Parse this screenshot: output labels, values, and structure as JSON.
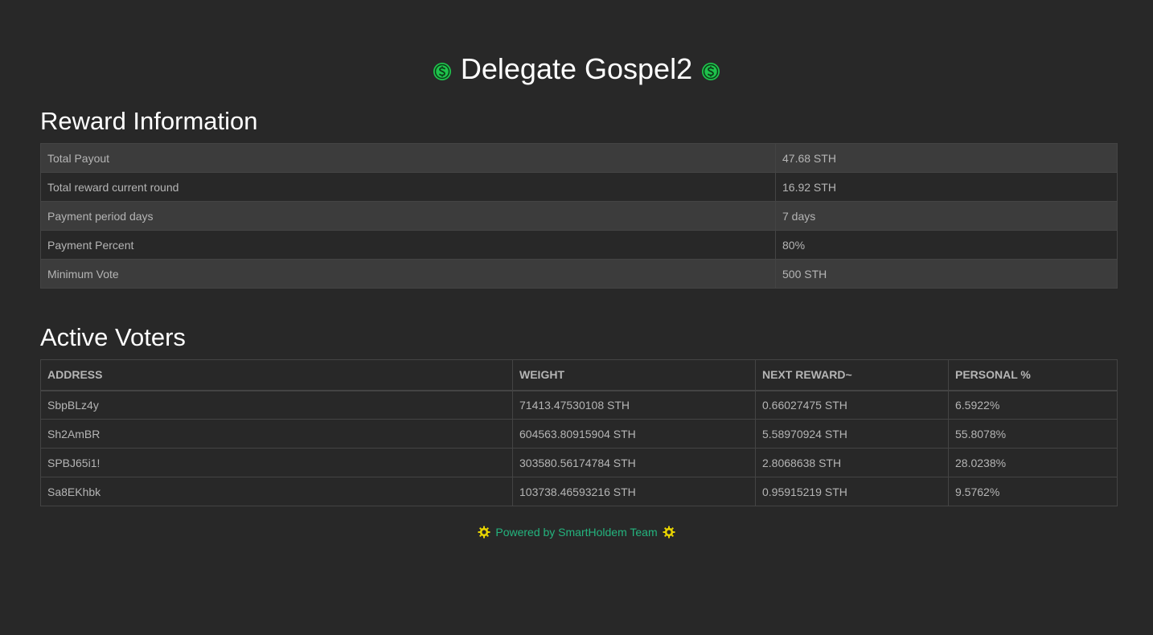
{
  "header": {
    "title": "Delegate Gospel2",
    "coin_icon": "smartholdem-coin-icon",
    "coin_color": "#1fc24c"
  },
  "reward_section": {
    "heading": "Reward Information",
    "rows": [
      {
        "label": "Total Payout",
        "value": "47.68 STH"
      },
      {
        "label": "Total reward current round",
        "value": "16.92 STH"
      },
      {
        "label": "Payment period days",
        "value": "7 days"
      },
      {
        "label": "Payment Percent",
        "value": "80%"
      },
      {
        "label": "Minimum Vote",
        "value": "500 STH"
      }
    ]
  },
  "voters_section": {
    "heading": "Active Voters",
    "columns": [
      "ADDRESS",
      "WEIGHT",
      "NEXT REWARD~",
      "PERSONAL %"
    ],
    "rows": [
      {
        "address": "SbpBLz4y",
        "weight": "71413.47530108 STH",
        "next_reward": "0.66027475 STH",
        "personal": "6.5922%"
      },
      {
        "address": "Sh2AmBR",
        "weight": "604563.80915904 STH",
        "next_reward": "5.58970924 STH",
        "personal": "55.8078%"
      },
      {
        "address": "SPBJ65i1!",
        "weight": "303580.56174784 STH",
        "next_reward": "2.8068638 STH",
        "personal": "28.0238%"
      },
      {
        "address": "Sa8EKhbk",
        "weight": "103738.46593216 STH",
        "next_reward": "0.95915219 STH",
        "personal": "9.5762%"
      }
    ]
  },
  "footer": {
    "text": "Powered by SmartHoldem Team",
    "icon": "gear-icon",
    "icon_color": "#e8d400",
    "text_color": "#24b47e"
  }
}
